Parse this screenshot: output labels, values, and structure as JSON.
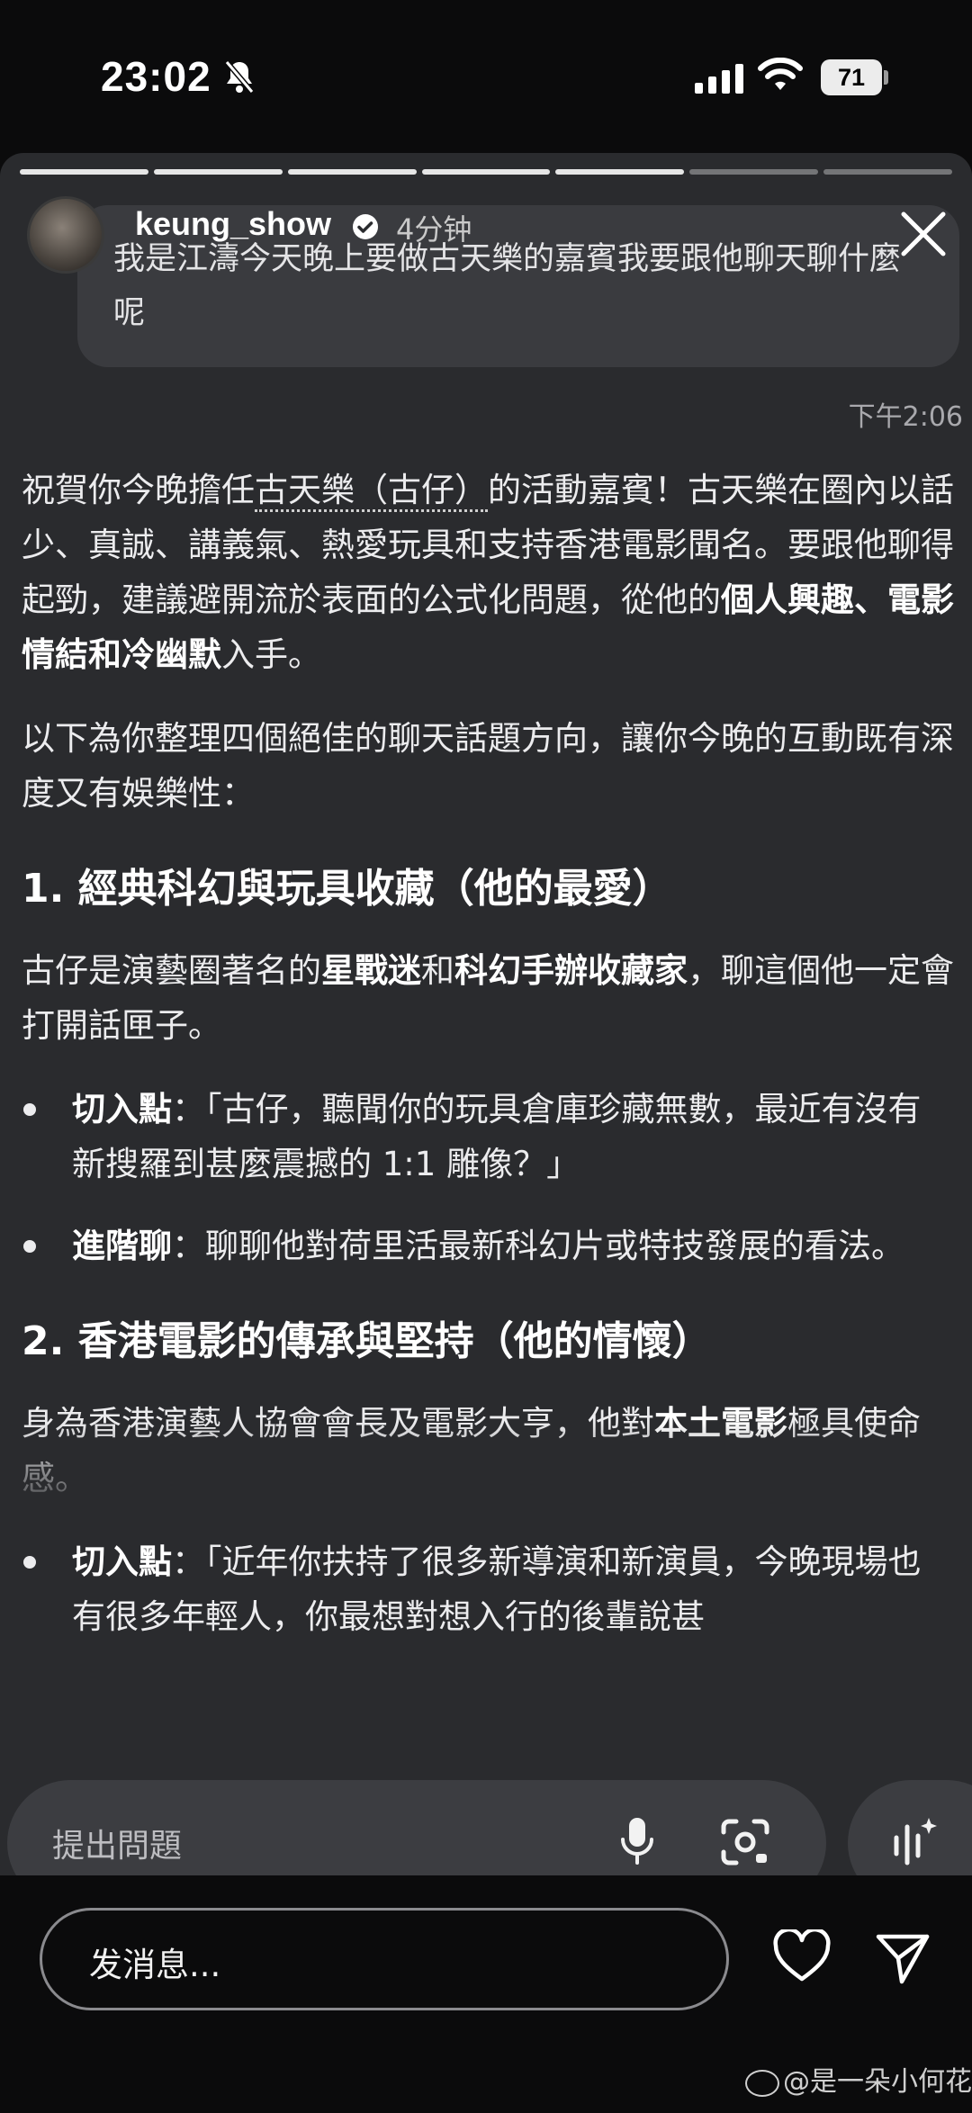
{
  "status": {
    "time": "23:02",
    "battery": "71"
  },
  "story": {
    "username": "keung_show",
    "time_ago": "4分钟",
    "progress_total": 7,
    "progress_done": 5
  },
  "chat": {
    "user_message": "我是江濤今天晚上要做古天樂的嘉賓我要跟他聊天聊什麼呢",
    "timestamp": "下午2:06",
    "intro_a": "祝賀你今晚擔任",
    "intro_link": "古天樂（古仔）",
    "intro_b": "的活動嘉賓！古天樂在圈內以話少、真誠、講義氣、熱愛玩具和支持香港電影聞名。要跟他聊得起勁，建議避開流於表面的公式化問題，從他的",
    "intro_bold": "個人興趣、電影情結和冷幽默",
    "intro_c": "入手。",
    "para2": "以下為你整理四個絕佳的聊天話題方向，讓你今晚的互動既有深度又有娛樂性：",
    "s1_title": "1. 經典科幻與玩具收藏（他的最愛）",
    "s1_a": "古仔是演藝圈著名的",
    "s1_b1": "星戰迷",
    "s1_and": "和",
    "s1_b2": "科幻手辦收藏家",
    "s1_c": "，聊這個他一定會打開話匣子。",
    "s1_i1_label": "切入點",
    "s1_i1_text": "：「古仔，聽聞你的玩具倉庫珍藏無數，最近有沒有新搜羅到甚麼震撼的 1:1 雕像？」",
    "s1_i2_label": "進階聊",
    "s1_i2_text": "：聊聊他對荷里活最新科幻片或特技發展的看法。",
    "s2_title": "2. 香港電影的傳承與堅持（他的情懷）",
    "s2_a": "身為香港演藝人協會會長及電影大亨，他對",
    "s2_b": "本土電影",
    "s2_c": "極具使命感。",
    "s2_i1_label": "切入點",
    "s2_i1_text": "：「近年你扶持了很多新導演和新演員，今晚現場也有很多年輕人，你最想對想入行的後輩說甚"
  },
  "input": {
    "ask_placeholder": "提出問題",
    "message_placeholder": "发消息..."
  },
  "watermark": "@是一朵小何花"
}
